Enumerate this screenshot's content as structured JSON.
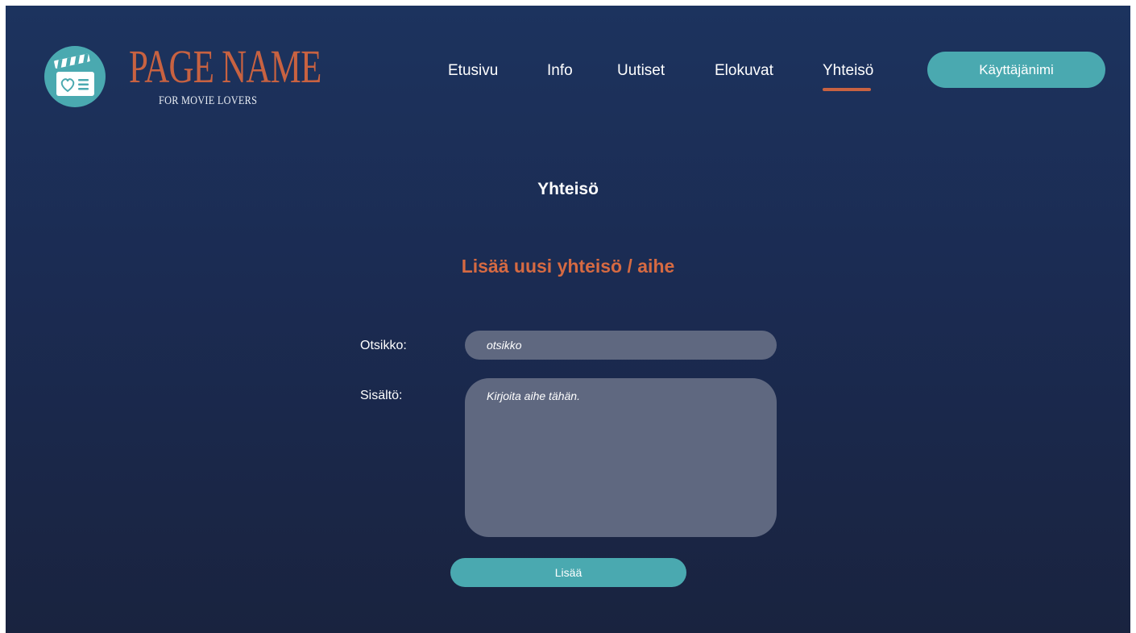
{
  "colors": {
    "accent_teal": "#4aa9b0",
    "accent_orange": "#c86241",
    "input_bg": "#5f6880",
    "background_top": "#1c335e",
    "background_bottom": "#19233f"
  },
  "header": {
    "logo": {
      "icon": "clapperboard-heart-icon",
      "brand_name": "PAGE NAME",
      "tagline": "FOR MOVIE LOVERS"
    },
    "nav": {
      "items": [
        {
          "label": "Etusivu",
          "active": false
        },
        {
          "label": "Info",
          "active": false
        },
        {
          "label": "Uutiset",
          "active": false
        },
        {
          "label": "Elokuvat",
          "active": false
        },
        {
          "label": "Yhteisö",
          "active": true
        }
      ]
    },
    "user_button_label": "Käyttäjänimi"
  },
  "main": {
    "page_title": "Yhteisö",
    "section_title": "Lisää uusi yhteisö / aihe",
    "form": {
      "title_label": "Otsikko:",
      "title_placeholder": "otsikko",
      "title_value": "",
      "content_label": "Sisältö:",
      "content_placeholder": "Kirjoita aihe tähän.",
      "content_value": "",
      "submit_label": "Lisää"
    }
  }
}
